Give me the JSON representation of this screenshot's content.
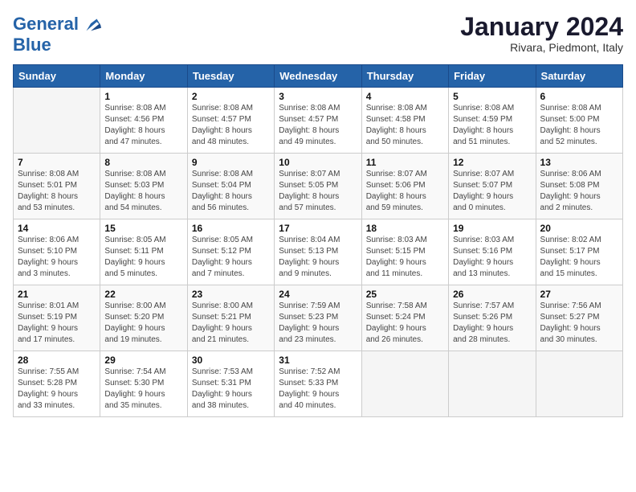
{
  "header": {
    "logo_line1": "General",
    "logo_line2": "Blue",
    "month_title": "January 2024",
    "location": "Rivara, Piedmont, Italy"
  },
  "days_of_week": [
    "Sunday",
    "Monday",
    "Tuesday",
    "Wednesday",
    "Thursday",
    "Friday",
    "Saturday"
  ],
  "weeks": [
    [
      {
        "num": "",
        "info": ""
      },
      {
        "num": "1",
        "info": "Sunrise: 8:08 AM\nSunset: 4:56 PM\nDaylight: 8 hours\nand 47 minutes."
      },
      {
        "num": "2",
        "info": "Sunrise: 8:08 AM\nSunset: 4:57 PM\nDaylight: 8 hours\nand 48 minutes."
      },
      {
        "num": "3",
        "info": "Sunrise: 8:08 AM\nSunset: 4:57 PM\nDaylight: 8 hours\nand 49 minutes."
      },
      {
        "num": "4",
        "info": "Sunrise: 8:08 AM\nSunset: 4:58 PM\nDaylight: 8 hours\nand 50 minutes."
      },
      {
        "num": "5",
        "info": "Sunrise: 8:08 AM\nSunset: 4:59 PM\nDaylight: 8 hours\nand 51 minutes."
      },
      {
        "num": "6",
        "info": "Sunrise: 8:08 AM\nSunset: 5:00 PM\nDaylight: 8 hours\nand 52 minutes."
      }
    ],
    [
      {
        "num": "7",
        "info": "Sunrise: 8:08 AM\nSunset: 5:01 PM\nDaylight: 8 hours\nand 53 minutes."
      },
      {
        "num": "8",
        "info": "Sunrise: 8:08 AM\nSunset: 5:03 PM\nDaylight: 8 hours\nand 54 minutes."
      },
      {
        "num": "9",
        "info": "Sunrise: 8:08 AM\nSunset: 5:04 PM\nDaylight: 8 hours\nand 56 minutes."
      },
      {
        "num": "10",
        "info": "Sunrise: 8:07 AM\nSunset: 5:05 PM\nDaylight: 8 hours\nand 57 minutes."
      },
      {
        "num": "11",
        "info": "Sunrise: 8:07 AM\nSunset: 5:06 PM\nDaylight: 8 hours\nand 59 minutes."
      },
      {
        "num": "12",
        "info": "Sunrise: 8:07 AM\nSunset: 5:07 PM\nDaylight: 9 hours\nand 0 minutes."
      },
      {
        "num": "13",
        "info": "Sunrise: 8:06 AM\nSunset: 5:08 PM\nDaylight: 9 hours\nand 2 minutes."
      }
    ],
    [
      {
        "num": "14",
        "info": "Sunrise: 8:06 AM\nSunset: 5:10 PM\nDaylight: 9 hours\nand 3 minutes."
      },
      {
        "num": "15",
        "info": "Sunrise: 8:05 AM\nSunset: 5:11 PM\nDaylight: 9 hours\nand 5 minutes."
      },
      {
        "num": "16",
        "info": "Sunrise: 8:05 AM\nSunset: 5:12 PM\nDaylight: 9 hours\nand 7 minutes."
      },
      {
        "num": "17",
        "info": "Sunrise: 8:04 AM\nSunset: 5:13 PM\nDaylight: 9 hours\nand 9 minutes."
      },
      {
        "num": "18",
        "info": "Sunrise: 8:03 AM\nSunset: 5:15 PM\nDaylight: 9 hours\nand 11 minutes."
      },
      {
        "num": "19",
        "info": "Sunrise: 8:03 AM\nSunset: 5:16 PM\nDaylight: 9 hours\nand 13 minutes."
      },
      {
        "num": "20",
        "info": "Sunrise: 8:02 AM\nSunset: 5:17 PM\nDaylight: 9 hours\nand 15 minutes."
      }
    ],
    [
      {
        "num": "21",
        "info": "Sunrise: 8:01 AM\nSunset: 5:19 PM\nDaylight: 9 hours\nand 17 minutes."
      },
      {
        "num": "22",
        "info": "Sunrise: 8:00 AM\nSunset: 5:20 PM\nDaylight: 9 hours\nand 19 minutes."
      },
      {
        "num": "23",
        "info": "Sunrise: 8:00 AM\nSunset: 5:21 PM\nDaylight: 9 hours\nand 21 minutes."
      },
      {
        "num": "24",
        "info": "Sunrise: 7:59 AM\nSunset: 5:23 PM\nDaylight: 9 hours\nand 23 minutes."
      },
      {
        "num": "25",
        "info": "Sunrise: 7:58 AM\nSunset: 5:24 PM\nDaylight: 9 hours\nand 26 minutes."
      },
      {
        "num": "26",
        "info": "Sunrise: 7:57 AM\nSunset: 5:26 PM\nDaylight: 9 hours\nand 28 minutes."
      },
      {
        "num": "27",
        "info": "Sunrise: 7:56 AM\nSunset: 5:27 PM\nDaylight: 9 hours\nand 30 minutes."
      }
    ],
    [
      {
        "num": "28",
        "info": "Sunrise: 7:55 AM\nSunset: 5:28 PM\nDaylight: 9 hours\nand 33 minutes."
      },
      {
        "num": "29",
        "info": "Sunrise: 7:54 AM\nSunset: 5:30 PM\nDaylight: 9 hours\nand 35 minutes."
      },
      {
        "num": "30",
        "info": "Sunrise: 7:53 AM\nSunset: 5:31 PM\nDaylight: 9 hours\nand 38 minutes."
      },
      {
        "num": "31",
        "info": "Sunrise: 7:52 AM\nSunset: 5:33 PM\nDaylight: 9 hours\nand 40 minutes."
      },
      {
        "num": "",
        "info": ""
      },
      {
        "num": "",
        "info": ""
      },
      {
        "num": "",
        "info": ""
      }
    ]
  ]
}
